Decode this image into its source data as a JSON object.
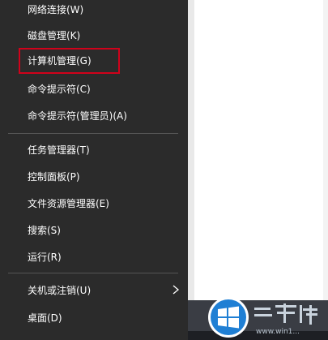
{
  "menu": {
    "items": [
      {
        "label": "网络连接(W)"
      },
      {
        "label": "磁盘管理(K)"
      },
      {
        "label": "计算机管理(G)"
      },
      {
        "label": "命令提示符(C)"
      },
      {
        "label": "命令提示符(管理员)(A)"
      },
      {
        "label": "任务管理器(T)"
      },
      {
        "label": "控制面板(P)"
      },
      {
        "label": "文件资源管理器(E)"
      },
      {
        "label": "搜索(S)"
      },
      {
        "label": "运行(R)"
      },
      {
        "label": "关机或注销(U)"
      },
      {
        "label": "桌面(D)"
      }
    ],
    "background": "#2b2b2b",
    "text_color": "#ffffff",
    "highlight_color": "#d0021b",
    "highlighted_item": "计算机管理(G)",
    "submenu_indicator": "chevron-right-icon"
  },
  "watermark": {
    "logo_icon": "windows-logo-icon",
    "url": "www.win1..."
  }
}
